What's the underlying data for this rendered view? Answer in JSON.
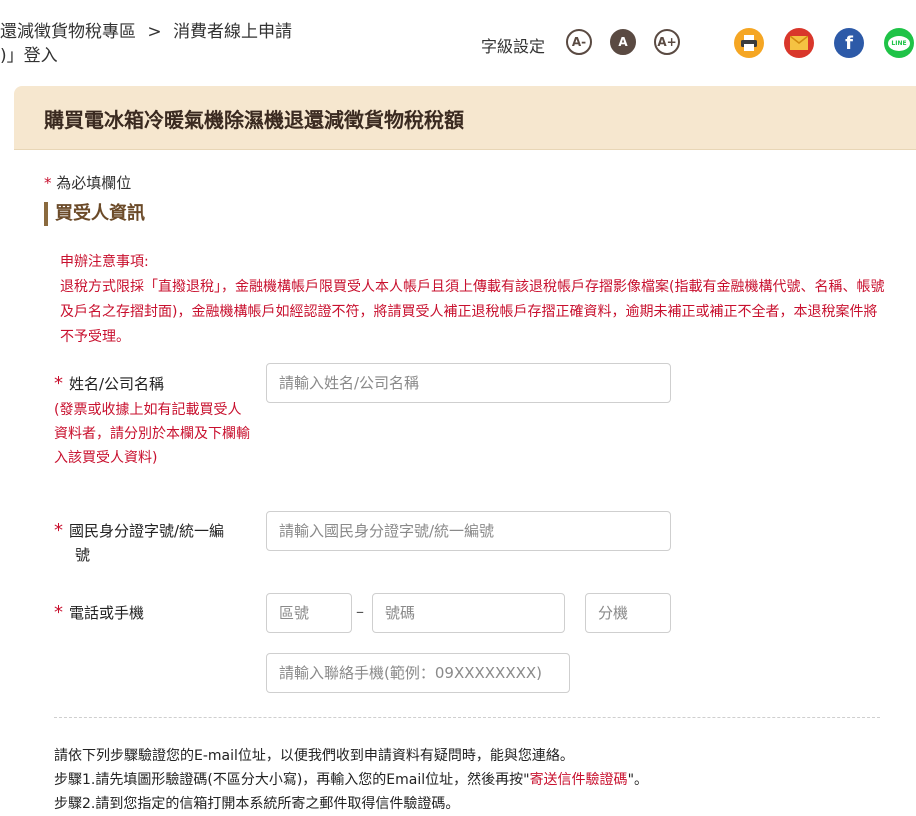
{
  "breadcrumb": {
    "line1_part1": "還減徵貨物稅專區",
    "separator": ">",
    "line1_part2": "消費者線上申請",
    "line2": ")」登入"
  },
  "font_settings": {
    "label": "字級設定",
    "small": "A-",
    "medium": "A",
    "large": "A+"
  },
  "share": {
    "line_text": "LINE",
    "facebook_glyph": "f",
    "colors": {
      "print": "#f5a623",
      "email": "#d9372b",
      "facebook": "#2d5aa8",
      "line": "#1fc347"
    },
    "icons": [
      "print-icon",
      "email-icon",
      "facebook-icon",
      "line-icon"
    ]
  },
  "page": {
    "title": "購買電冰箱冷暖氣機除濕機退還減徵貨物稅稅額"
  },
  "form": {
    "required_star": "*",
    "required_note": "為必填欄位",
    "section_title": "買受人資訊",
    "notice_title": "申辦注意事項:",
    "notice_body": "退稅方式限採「直撥退稅」，金融機構帳戶限買受人本人帳戶且須上傳載有該退稅帳戶存摺影像檔案(指載有金融機構代號、名稱、帳號 及戶名之存摺封面)，金融機構帳戶如經認證不符，將請買受人補正退稅帳戶存摺正確資料，逾期未補正或補正不全者，本退稅案件將不予受理。",
    "name": {
      "label": "姓名/公司名稱",
      "hint": "(發票或收據上如有記載買受人資料者，請分別於本欄及下欄輸入該買受人資料)",
      "placeholder": "請輸入姓名/公司名稱",
      "value": ""
    },
    "id_number": {
      "label": "國民身分證字號/統一編",
      "label_line2": "號",
      "placeholder": "請輸入國民身分證字號/統一編號",
      "value": ""
    },
    "phone": {
      "label": "電話或手機",
      "area_placeholder": "區號",
      "dash": "–",
      "number_placeholder": "號碼",
      "ext_placeholder": "分機",
      "mobile_placeholder": "請輸入聯絡手機(範例：09XXXXXXXX)"
    }
  },
  "email_info": {
    "line1": "請依下列步驟驗證您的E-mail位址，以便我們收到申請資料有疑問時，能與您連絡。",
    "line2_part1": "步驟1.請先填圖形驗證碼(不區分大小寫)，再輸入您的Email位址，然後再按\"",
    "line2_link": "寄送信件驗證碼",
    "line2_part2": "\"。",
    "line3": "步驟2.請到您指定的信箱打開本系統所寄之郵件取得信件驗證碼。"
  }
}
